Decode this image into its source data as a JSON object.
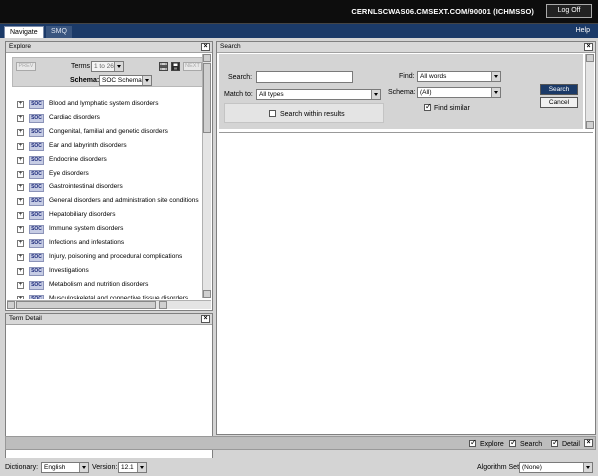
{
  "header": {
    "server": "CERNLSCWAS06.CMSEXT.COM/90001  (ICHMSSO)",
    "logoff_label": "Log Off"
  },
  "tabs": {
    "navigate": "Navigate",
    "smq": "SMQ",
    "help": "Help"
  },
  "explore": {
    "title": "Explore",
    "prev_label": "PREV",
    "next_label": "NEXT",
    "terms_label": "Terms",
    "terms_range": "1 to 26",
    "schema_label": "Schema:",
    "schema_value": "SOC Schema",
    "badge": "SOC",
    "items": [
      "Blood and lymphatic system disorders",
      "Cardiac disorders",
      "Congenital, familial and genetic disorders",
      "Ear and labyrinth disorders",
      "Endocrine disorders",
      "Eye disorders",
      "Gastrointestinal disorders",
      "General disorders and administration site conditions",
      "Hepatobiliary disorders",
      "Immune system disorders",
      "Infections and infestations",
      "Injury, poisoning and procedural complications",
      "Investigations",
      "Metabolism and nutrition disorders",
      "Musculoskeletal and connective tissue disorders"
    ]
  },
  "term_detail": {
    "title": "Term Detail"
  },
  "search": {
    "title": "Search",
    "search_label": "Search:",
    "search_value": "",
    "find_label": "Find:",
    "find_value": "All words",
    "match_label": "Match to:",
    "match_value": "All types",
    "schema_label": "Schema:",
    "schema_value": "(All)",
    "find_similar_label": "Find similar",
    "find_similar_checked": true,
    "within_label": "Search within results",
    "within_checked": false,
    "search_button": "Search",
    "cancel_button": "Cancel"
  },
  "panel_toggles": {
    "explore_label": "Explore",
    "search_label": "Search",
    "detail_label": "Detail"
  },
  "footer": {
    "dictionary_label": "Dictionary:",
    "dictionary_value": "English",
    "version_label": "Version:",
    "version_value": "12.1",
    "algorithm_label": "Algorithm Set:",
    "algorithm_value": "(None)"
  }
}
